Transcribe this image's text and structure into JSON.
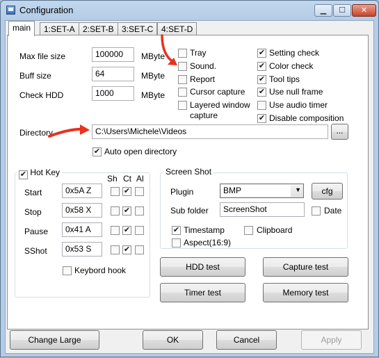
{
  "window": {
    "title": "Configuration",
    "min_glyph": "▁",
    "max_glyph": "☐",
    "close_glyph": "✕"
  },
  "tabs": [
    "main",
    "1:SET-A",
    "2:SET-B",
    "3:SET-C",
    "4:SET-D"
  ],
  "fields": {
    "max_file_size": {
      "label": "Max file size",
      "value": "100000",
      "unit": "MByte"
    },
    "buff_size": {
      "label": "Buff size",
      "value": "64",
      "unit": "MByte"
    },
    "check_hdd": {
      "label": "Check HDD",
      "value": "1000",
      "unit": "MByte"
    }
  },
  "options_left": [
    {
      "label": "Tray",
      "checked": false
    },
    {
      "label": "Sound.",
      "checked": false
    },
    {
      "label": "Report",
      "checked": false
    },
    {
      "label": "Cursor capture",
      "checked": false
    },
    {
      "label": "Layered window",
      "label2": "capture",
      "checked": false
    }
  ],
  "options_right": [
    {
      "label": "Setting check",
      "checked": true
    },
    {
      "label": "Color check",
      "checked": true
    },
    {
      "label": "Tool tips",
      "checked": true
    },
    {
      "label": "Use null frame",
      "checked": true
    },
    {
      "label": "Use audio timer",
      "checked": false
    },
    {
      "label": "Disable composition",
      "checked": true
    }
  ],
  "directory": {
    "label": "Directory",
    "value": "C:\\Users\\Michele\\Videos",
    "browse_label": "...",
    "auto_open_label": "Auto open directory",
    "auto_open_checked": true
  },
  "hotkey": {
    "title": "Hot Key",
    "enabled": true,
    "col_headers": [
      "Sh",
      "Ct",
      "Al"
    ],
    "rows": [
      {
        "label": "Start",
        "value": "0x5A Z",
        "sh": false,
        "ct": true,
        "al": false
      },
      {
        "label": "Stop",
        "value": "0x58 X",
        "sh": false,
        "ct": true,
        "al": false
      },
      {
        "label": "Pause",
        "value": "0x41 A",
        "sh": false,
        "ct": true,
        "al": false
      },
      {
        "label": "SShot",
        "value": "0x53 S",
        "sh": false,
        "ct": true,
        "al": false
      }
    ],
    "keyboard_hook_label": "Keybord hook",
    "keyboard_hook_checked": false
  },
  "screenshot": {
    "title": "Screen Shot",
    "plugin_label": "Plugin",
    "plugin_value": "BMP",
    "cfg_label": "cfg",
    "subfolder_label": "Sub folder",
    "subfolder_value": "ScreenShot",
    "date_label": "Date",
    "date_checked": false,
    "timestamp_label": "Timestamp",
    "timestamp_checked": true,
    "clipboard_label": "Clipboard",
    "clipboard_checked": false,
    "aspect_label": "Aspect(16:9)",
    "aspect_checked": false
  },
  "test_buttons": {
    "hdd": "HDD test",
    "capture": "Capture test",
    "timer": "Timer test",
    "memory": "Memory test"
  },
  "bottom_buttons": {
    "change_large": "Change Large",
    "ok": "OK",
    "cancel": "Cancel",
    "apply": "Apply"
  },
  "colors": {
    "annotation_arrow": "#e8321e",
    "check_mark": "#1c1c1c"
  },
  "check_glyph": "✔"
}
